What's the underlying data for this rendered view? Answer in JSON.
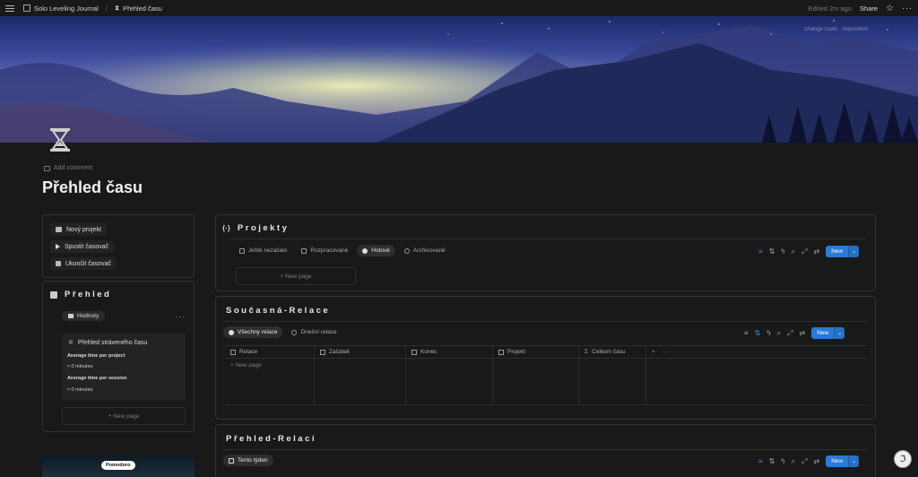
{
  "topbar": {
    "workspace": "Solo Leveling Journal",
    "page": "Přehled času",
    "edited": "Edited 2m ago",
    "share": "Share"
  },
  "cover": {
    "change": "Change cover",
    "reposition": "Reposition"
  },
  "page": {
    "add_comment": "Add comment",
    "title": "Přehled času"
  },
  "sidebar": {
    "buttons": [
      "Nový projekt",
      "Spustit časovač",
      "Ukončit časovač"
    ],
    "prehled": {
      "title": "Přehled",
      "view_chip": "Hodnoty",
      "card": {
        "title": "Přehled stráveného času",
        "avg_project_label": "Average time per project",
        "avg_project_value": "≈ 0 minutes",
        "avg_session_label": "Average time per session",
        "avg_session_value": "≈ 0 minutes"
      },
      "new_page": "+ New page"
    },
    "pomodoro": "Pomodoro"
  },
  "projekty": {
    "title": "Projekty",
    "tabs": [
      "Ještě nezačalo",
      "Rozpracované",
      "Hotové",
      "Archivované"
    ],
    "active_tab": 2,
    "new_page": "+ New page",
    "new_label": "New"
  },
  "soucasna": {
    "title": "Současná-Relace",
    "tabs": [
      "Všechny relace",
      "Dnešní relace"
    ],
    "columns": [
      "Relace",
      "Začátek",
      "Konec",
      "Projekt",
      "Celkem času"
    ],
    "new_page": "+ New page",
    "new_label": "New"
  },
  "prehled_relaci": {
    "title": "Přehled-Relací",
    "tab": "Tento týden",
    "new_label": "New"
  },
  "colors": {
    "accent": "#2a7ad6",
    "bg": "#191919"
  }
}
